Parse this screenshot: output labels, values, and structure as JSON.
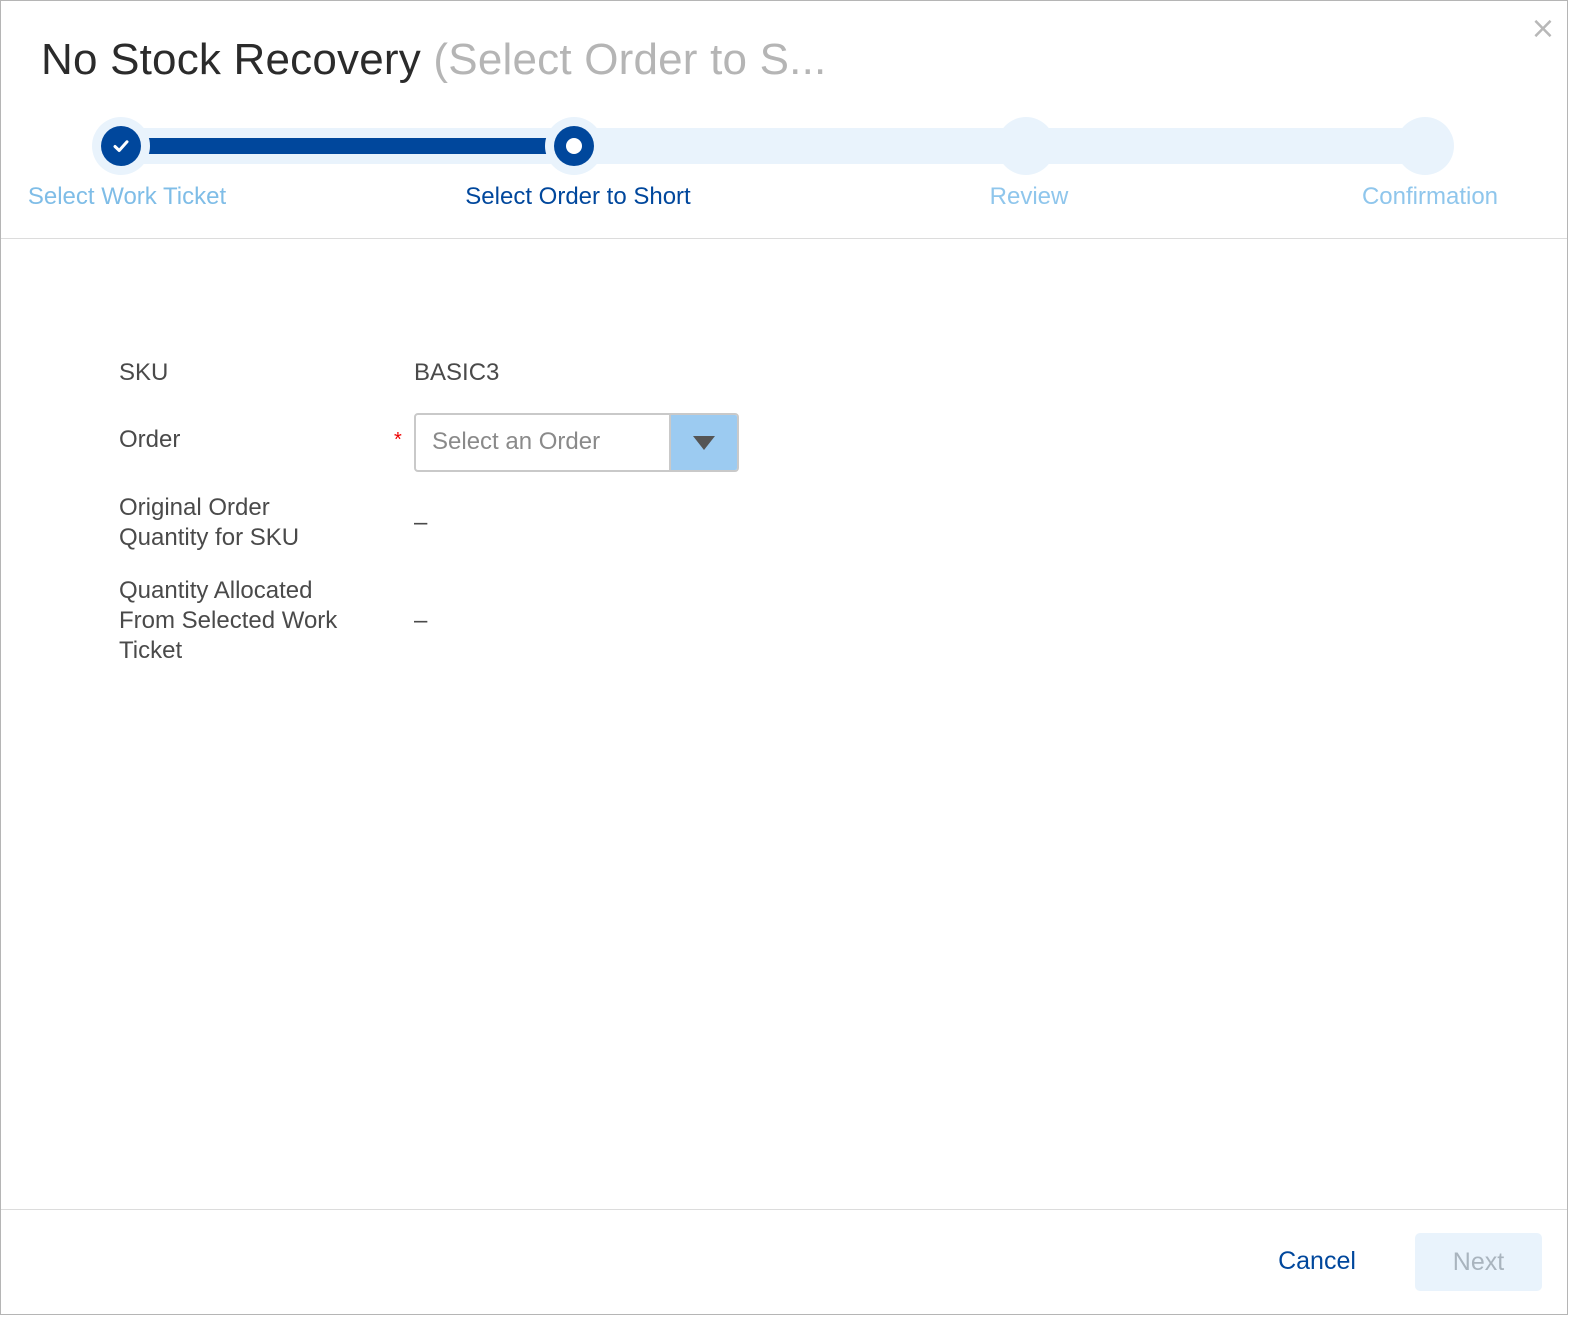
{
  "dialog": {
    "title_main": "No Stock Recovery",
    "title_sub": "(Select Order to S...",
    "close_symbol": "×"
  },
  "stepper": {
    "steps": [
      {
        "label": "Select Work Ticket",
        "state": "complete"
      },
      {
        "label": "Select Order to Short",
        "state": "active"
      },
      {
        "label": "Review",
        "state": "pending"
      },
      {
        "label": "Confirmation",
        "state": "pending"
      }
    ]
  },
  "form": {
    "sku_label": "SKU",
    "sku_value": "BASIC3",
    "order_label": "Order",
    "order_required_mark": "*",
    "order_placeholder": "Select an Order",
    "original_qty_label_line1": "Original Order",
    "original_qty_label_line2": "Quantity for SKU",
    "original_qty_value": "–",
    "allocated_label_line1": "Quantity Allocated",
    "allocated_label_line2": "From Selected Work",
    "allocated_label_line3": "Ticket",
    "allocated_value": "–"
  },
  "footer": {
    "cancel_label": "Cancel",
    "next_label": "Next"
  },
  "colors": {
    "primary": "#00479c",
    "track": "#e9f3fc",
    "pending_label": "#8fc6ec",
    "select_arrow_bg": "#9ccbf1"
  }
}
